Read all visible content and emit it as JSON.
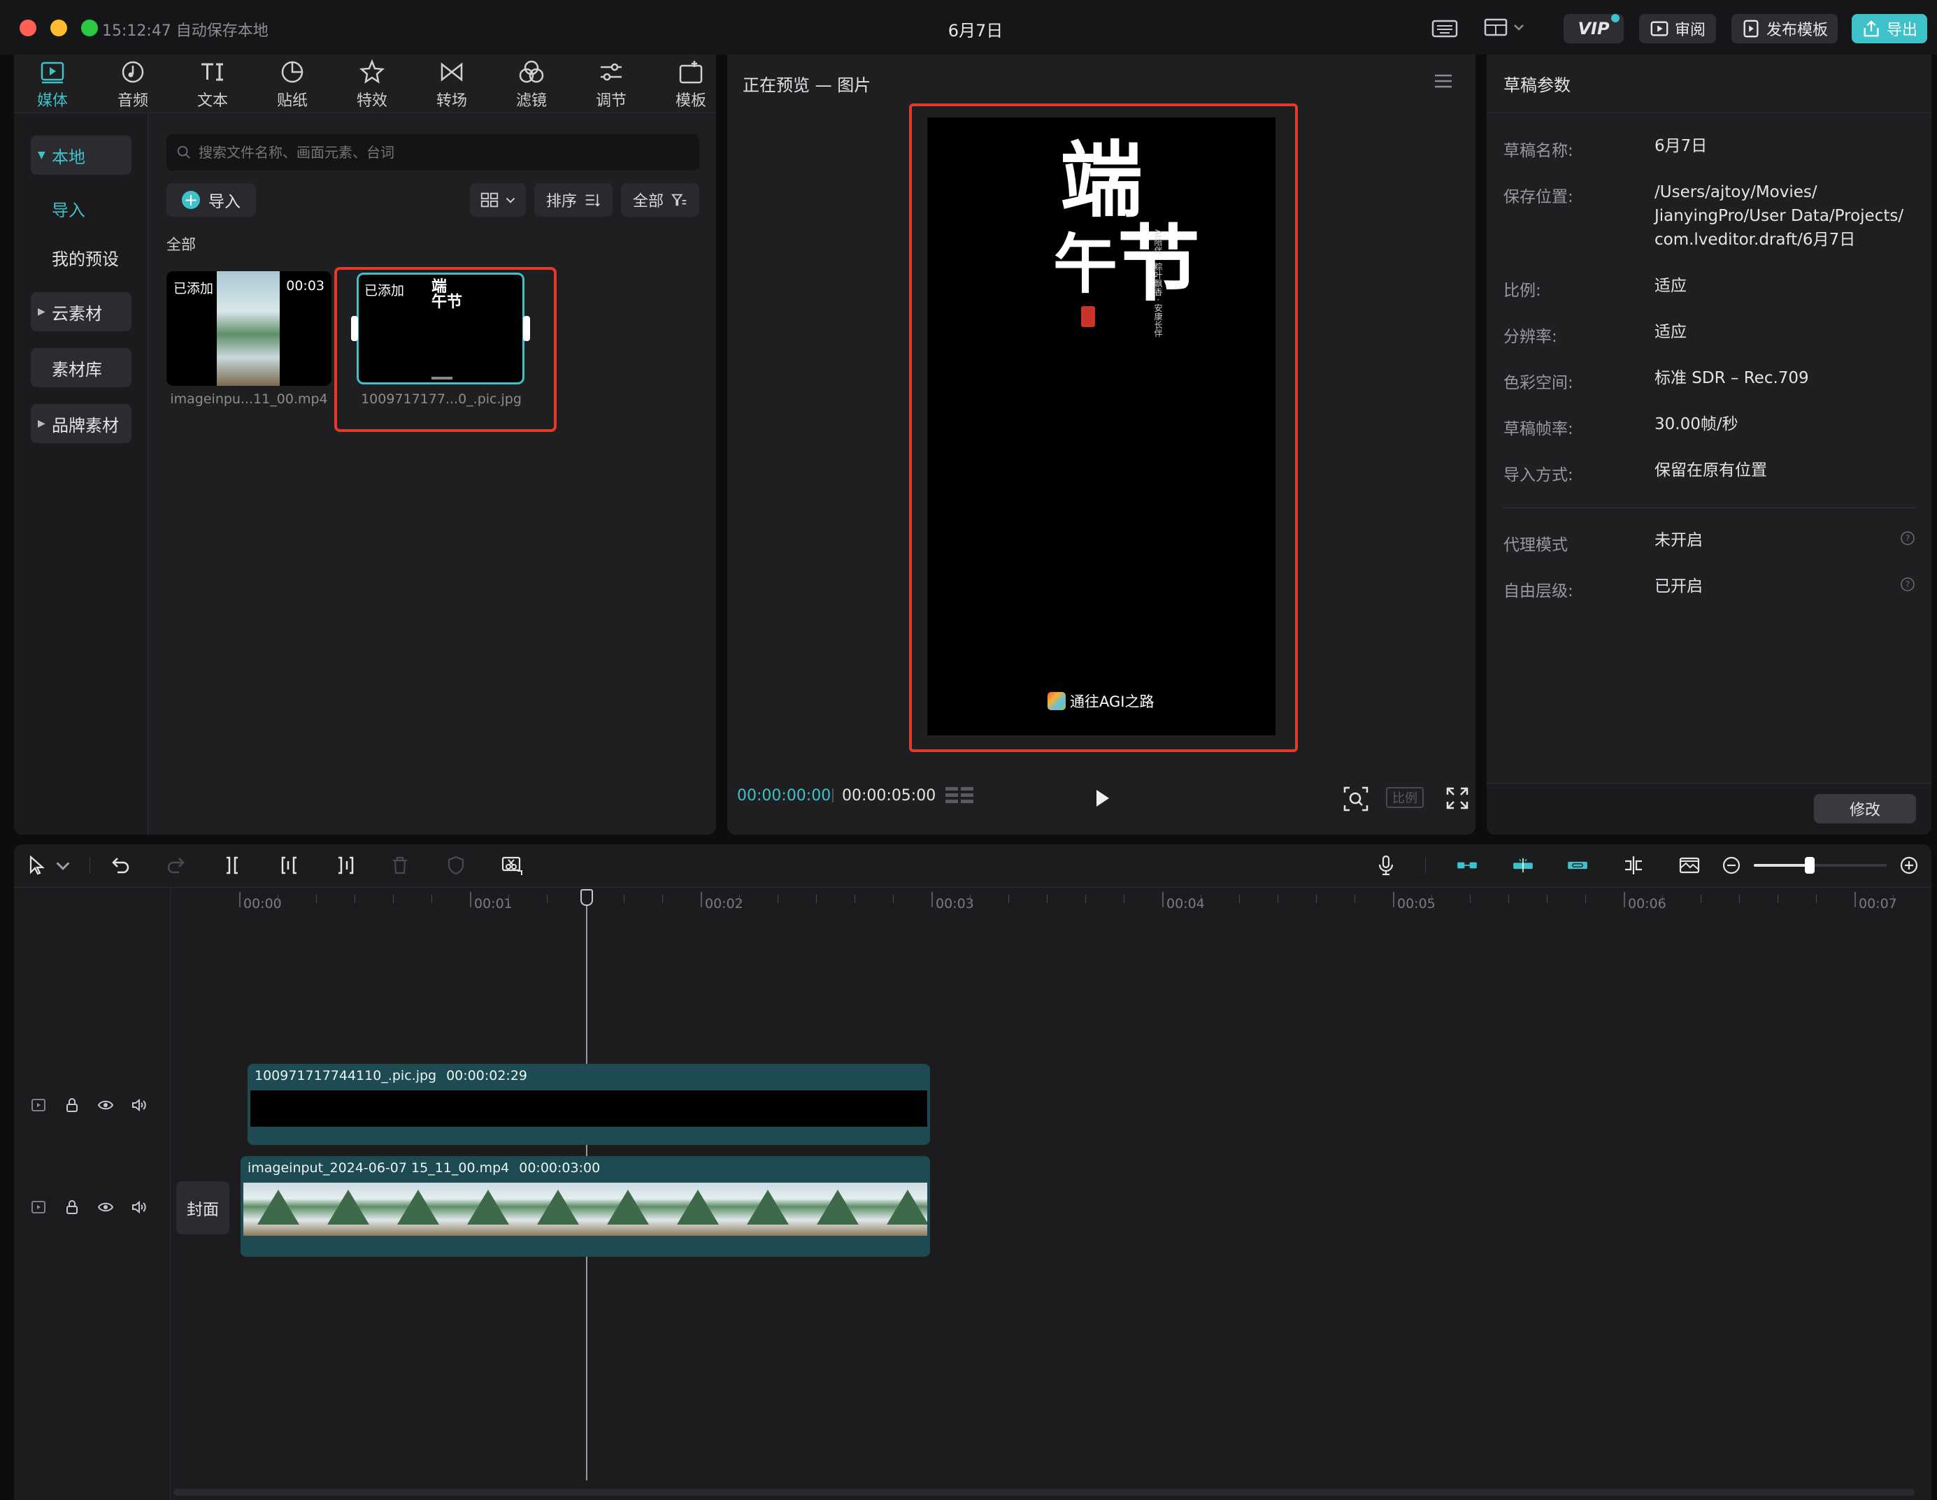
{
  "titlebar": {
    "autosave": "15:12:47 自动保存本地",
    "project_title": "6月7日",
    "vip_label": "VIP",
    "review_label": "审阅",
    "publish_label": "发布模板",
    "export_label": "导出"
  },
  "media_tabs": [
    {
      "label": "媒体",
      "icon": "media-icon",
      "active": true
    },
    {
      "label": "音频",
      "icon": "audio-icon"
    },
    {
      "label": "文本",
      "icon": "text-icon"
    },
    {
      "label": "贴纸",
      "icon": "sticker-icon"
    },
    {
      "label": "特效",
      "icon": "effects-icon"
    },
    {
      "label": "转场",
      "icon": "transition-icon"
    },
    {
      "label": "滤镜",
      "icon": "filter-icon"
    },
    {
      "label": "调节",
      "icon": "adjust-icon"
    },
    {
      "label": "模板",
      "icon": "template-icon"
    }
  ],
  "sidebar": {
    "local": "本地",
    "import": "导入",
    "presets": "我的预设",
    "cloud": "云素材",
    "library": "素材库",
    "brand": "品牌素材"
  },
  "media": {
    "search_placeholder": "搜索文件名称、画面元素、台词",
    "import_label": "导入",
    "sort_label": "排序",
    "filter_label": "全部",
    "section_label": "全部",
    "items": [
      {
        "tag": "已添加",
        "duration": "00:03",
        "name": "imageinpu...11_00.mp4"
      },
      {
        "tag": "已添加",
        "name": "1009717177...0_.pic.jpg"
      }
    ]
  },
  "preview": {
    "title": "正在预览 — 图片",
    "current_time": "00:00:00:00",
    "total_time": "00:00:05:00",
    "ratio_label": "比例",
    "poster_title_chars": [
      "端",
      "午",
      "节"
    ],
    "poster_side_text": "AI陪伴 · 粽叶飘香 · 安康长伴",
    "poster_brand": "通往AGI之路"
  },
  "draft_params": {
    "title": "草稿参数",
    "rows": [
      {
        "label": "草稿名称:",
        "value": "6月7日"
      },
      {
        "label": "保存位置:",
        "value": "/Users/ajtoy/Movies/\nJianyingPro/User Data/Projects/\ncom.lveditor.draft/6月7日"
      },
      {
        "label": "比例:",
        "value": "适应"
      },
      {
        "label": "分辨率:",
        "value": "适应"
      },
      {
        "label": "色彩空间:",
        "value": "标准 SDR – Rec.709"
      },
      {
        "label": "草稿帧率:",
        "value": "30.00帧/秒"
      },
      {
        "label": "导入方式:",
        "value": "保留在原有位置"
      }
    ],
    "proxy_label": "代理模式",
    "proxy_value": "未开启",
    "layer_label": "自由层级:",
    "layer_value": "已开启",
    "modify_label": "修改"
  },
  "timeline": {
    "ruler": [
      "00:00",
      "00:01",
      "00:02",
      "00:03",
      "00:04",
      "00:05",
      "00:06",
      "00:07"
    ],
    "track1": {
      "name": "100971717744110_.pic.jpg",
      "duration": "00:00:02:29"
    },
    "track2": {
      "name": "imageinput_2024-06-07 15_11_00.mp4",
      "duration": "00:00:03:00"
    },
    "cover_label": "封面",
    "zoom_level": 0.42
  },
  "colors": {
    "accent": "#3fc1c9",
    "highlight": "#e53a2b",
    "clip_bg": "#1e4a52",
    "panel": "#1f1f22"
  }
}
